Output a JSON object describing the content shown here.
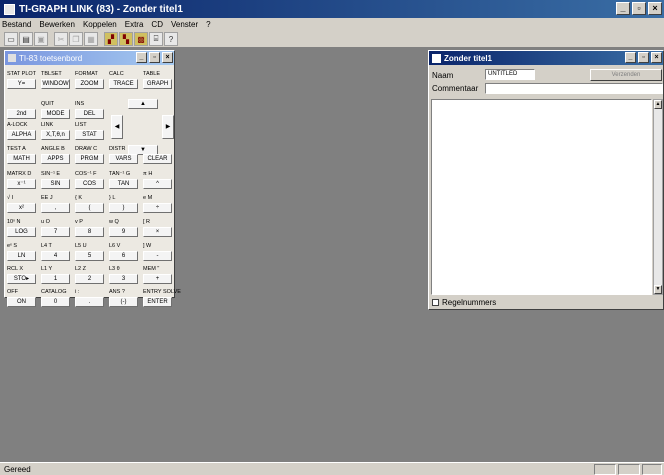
{
  "window": {
    "title": "TI-GRAPH LINK (83) - Zonder titel1",
    "min": "_",
    "max": "▫",
    "close": "×"
  },
  "menu": [
    "Bestand",
    "Bewerken",
    "Koppelen",
    "Extra",
    "CD",
    "Venster",
    "?"
  ],
  "toolbar_icons": [
    "new-icon",
    "open-icon",
    "save-icon",
    "cut-icon",
    "copy-icon",
    "paste-icon",
    "send-icon",
    "receive-icon",
    "screen-icon",
    "link-icon",
    "help-icon"
  ],
  "calculator": {
    "title": "TI-83 toetsenbord",
    "rows": [
      {
        "labels": [
          "STAT PLOT",
          "TBLSET",
          "FORMAT",
          "CALC",
          "TABLE"
        ],
        "keys": [
          "Y=",
          "WINDOW",
          "ZOOM",
          "TRACE",
          "GRAPH"
        ]
      },
      {
        "labels": [
          "QUIT",
          "INS"
        ],
        "keys": [
          "2nd",
          "MODE",
          "DEL"
        ]
      },
      {
        "labels": [
          "A-LOCK",
          "LINK",
          "LIST"
        ],
        "keys": [
          "ALPHA",
          "X,T,θ,n",
          "STAT"
        ]
      },
      {
        "labels": [
          "TEST A",
          "ANGLE B",
          "DRAW C",
          "DISTR"
        ],
        "keys": [
          "MATH",
          "APPS",
          "PRGM",
          "VARS",
          "CLEAR"
        ]
      },
      {
        "labels": [
          "MATRX D",
          "SIN⁻¹ E",
          "COS⁻¹ F",
          "TAN⁻¹ G",
          "π H"
        ],
        "keys": [
          "x⁻¹",
          "SIN",
          "COS",
          "TAN",
          "^"
        ]
      },
      {
        "labels": [
          "√ I",
          "EE J",
          "{ K",
          "} L",
          "e M"
        ],
        "keys": [
          "x²",
          ",",
          "(",
          ")",
          "÷"
        ]
      },
      {
        "labels": [
          "10ˣ N",
          "u O",
          "v P",
          "w Q",
          "[ R"
        ],
        "keys": [
          "LOG",
          "7",
          "8",
          "9",
          "×"
        ]
      },
      {
        "labels": [
          "eˣ S",
          "L4 T",
          "L5 U",
          "L6 V",
          "] W"
        ],
        "keys": [
          "LN",
          "4",
          "5",
          "6",
          "-"
        ]
      },
      {
        "labels": [
          "RCL X",
          "L1 Y",
          "L2 Z",
          "L3 θ",
          "MEM \""
        ],
        "keys": [
          "STO▸",
          "1",
          "2",
          "3",
          "+"
        ]
      },
      {
        "labels": [
          "OFF",
          "CATALOG",
          "i :",
          "ANS ?",
          "ENTRY SOLVE"
        ],
        "keys": [
          "ON",
          "0",
          ".",
          "(-)",
          "ENTER"
        ]
      }
    ],
    "arrows": {
      "up": "▲",
      "down": "▼",
      "left": "◀",
      "right": "▶"
    }
  },
  "editor": {
    "title": "Zonder titel1",
    "name_label": "Naam",
    "name_value": "UNTITLED",
    "verify_button": "Verzenden",
    "comment_label": "Commentaar",
    "comment_value": "",
    "checkbox_label": "Regelnummers"
  },
  "status": {
    "text": "Gereed"
  }
}
